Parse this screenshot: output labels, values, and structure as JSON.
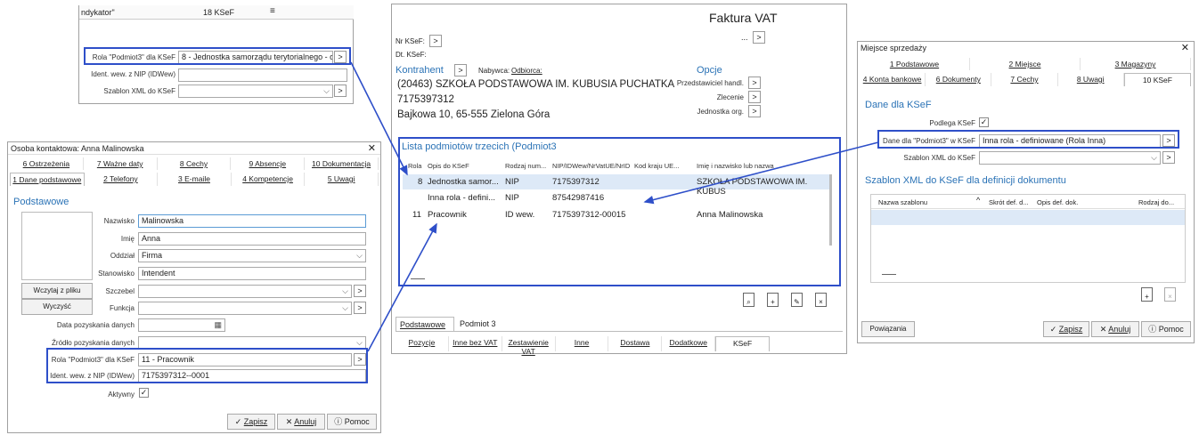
{
  "w1": {
    "header_label": "ndykator\"",
    "header_value": "18 KSeF",
    "rola_label": "Rola \"Podmiot3\" dla KSeF",
    "rola_value": "8 - Jednostka samorządu terytorialnego - o",
    "ident_label": "Ident. wew. z NIP (IDWew)",
    "szablon_label": "Szablon XML do KSeF"
  },
  "w2": {
    "title": "Osoba kontaktowa: Anna Malinowska",
    "tabs_row1": [
      "6 Ostrzeżenia",
      "7 Ważne daty",
      "8 Cechy",
      "9 Absencje",
      "10 Dokumentacja"
    ],
    "tabs_row2": [
      "1 Dane podstawowe",
      "2 Telefony",
      "3 E-maile",
      "4 Kompetencje",
      "5 Uwagi"
    ],
    "section": "Podstawowe",
    "fields": [
      {
        "label": "Nazwisko",
        "value": "Malinowska"
      },
      {
        "label": "Imię",
        "value": "Anna"
      },
      {
        "label": "Oddział",
        "value": "Firma"
      },
      {
        "label": "Stanowisko",
        "value": "Intendent"
      },
      {
        "label": "Szczebel",
        "value": ""
      },
      {
        "label": "Funkcja",
        "value": ""
      },
      {
        "label": "Data pozyskania danych",
        "value": ""
      },
      {
        "label": "Źródło pozyskania danych",
        "value": ""
      },
      {
        "label": "Rola \"Podmiot3\" dla KSeF",
        "value": "11 - Pracownik"
      },
      {
        "label": "Ident. wew. z NIP (IDWew)",
        "value": "7175397312--0001"
      },
      {
        "label": "Aktywny",
        "value": "✓"
      }
    ],
    "btn_load": "Wczytaj z pliku",
    "btn_clear": "Wyczyść",
    "btn_save": "Zapisz",
    "btn_cancel": "Anuluj",
    "btn_help": "Pomoc"
  },
  "w3": {
    "title": "Faktura VAT",
    "nr_ksef": "Nr KSeF:",
    "dt_ksef": "Dt. KSeF:",
    "ellipsis": "...",
    "kontrahent": "Kontrahent",
    "nabywca_label": "Nabywca:",
    "nabywca_value": "Odbiorca:",
    "client_line1": "(20463) SZKOŁA PODSTAWOWA IM. KUBUSIA PUCHATKA",
    "client_line2": "7175397312",
    "client_line3": "Bajkowa 10, 65-555 Zielona Góra",
    "opcje": "Opcje",
    "opt1": "Przedstawiciel handl.",
    "opt2": "Zlecenie",
    "opt3": "Jednostka org.",
    "list_title": "Lista podmiotów trzecich (Podmiot3",
    "columns": [
      "Rola",
      "Opis do KSeF",
      "Rodzaj num...",
      "NIP/IDWew/NrVatUE/NrID",
      "Kod kraju UE...",
      "Imię i nazwisko lub nazwa"
    ],
    "rows": [
      [
        "8",
        "Jednostka samor...",
        "NIP",
        "7175397312",
        "",
        "SZKOŁA PODSTAWOWA IM. KUBUS"
      ],
      [
        "",
        "Inna rola - defini...",
        "NIP",
        "87542987416",
        "",
        ""
      ],
      [
        "11",
        "Pracownik",
        "ID wew.",
        "7175397312-00015",
        "",
        "Anna Malinowska"
      ]
    ],
    "bottom_tabs": [
      "Podstawowe",
      "Podmiot 3"
    ],
    "nav_tabs": [
      "Pozycje",
      "Inne bez VAT",
      "Zestawienie VAT",
      "Inne",
      "Dostawa",
      "Dodatkowe",
      "KSeF"
    ]
  },
  "w4": {
    "title": "Miejsce sprzedaży",
    "tabs_row1": [
      "1 Podstawowe",
      "2 Miejsce",
      "3 Magazyny"
    ],
    "tabs_row2": [
      "4 Konta bankowe",
      "6 Dokumenty",
      "7 Cechy",
      "8 Uwagi",
      "10 KSeF"
    ],
    "section1": "Dane dla KSeF",
    "podlega": "Podlega KSeF",
    "dane_label": "Dane dla \"Podmiot3\" w KSeF",
    "dane_value": "Inna rola - definiowane (Rola Inna)",
    "szablon_label": "Szablon XML do KSeF",
    "section2": "Szablon XML do KSeF dla definicji dokumentu",
    "columns": [
      "Nazwa szablonu",
      "Skrót def. d...",
      "Opis def. dok.",
      "Rodzaj do..."
    ],
    "btn_links": "Powiązania",
    "btn_save": "Zapisz",
    "btn_cancel": "Anuluj",
    "btn_help": "Pomoc"
  }
}
